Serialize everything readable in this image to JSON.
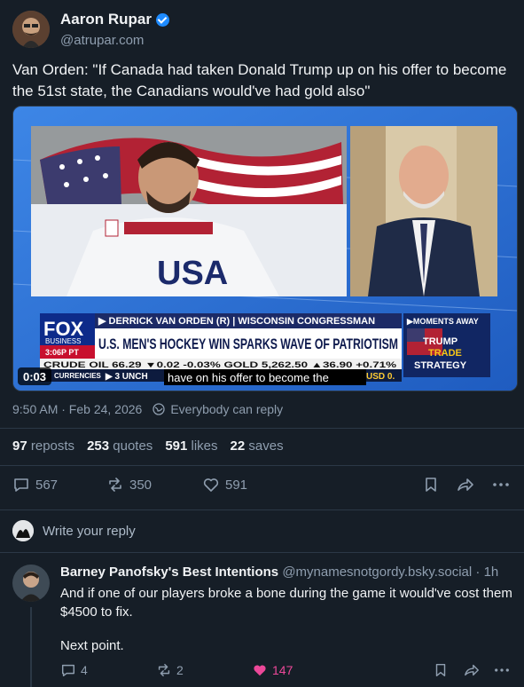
{
  "post": {
    "author_name": "Aaron Rupar",
    "author_handle": "@atrupar.com",
    "text": "Van Orden: \"If Canada had taken Donald Trump up on his offer to become the 51st state, the Canadians would've had gold also\"",
    "timestamp": "9:50 AM · Feb 24, 2026",
    "reply_setting": "Everybody can reply",
    "stats": {
      "reposts_count": "97",
      "reposts_label": "reposts",
      "quotes_count": "253",
      "quotes_label": "quotes",
      "likes_count": "591",
      "likes_label": "likes",
      "saves_count": "22",
      "saves_label": "saves"
    },
    "actions": {
      "replies": "567",
      "reposts": "350",
      "likes": "591"
    }
  },
  "video": {
    "duration": "0:03",
    "caption": "have on his offer to become the",
    "channel_logo": "FOX",
    "channel_sub": "BUSINESS",
    "clock": "3:06P PT",
    "lower_third_top": "▶ DERRICK VAN ORDEN (R) | WISCONSIN CONGRESSMAN",
    "headline": "U.S. MEN'S HOCKEY WIN SPARKS WAVE OF PATRIOTISM",
    "moments_away": "▶MOMENTS AWAY",
    "promo_line1": "TRUMP",
    "promo_line2": "TRADE",
    "promo_line3": "STRATEGY",
    "ticker_row1": "CRUDE OIL     66.29 ▼0.02  -0.03%  GOLD       5,262.50 ▲36.90 +0.71%",
    "ticker_row2_label": "CURRENCIES",
    "ticker_row2_rest": "▶ 3  UNCH",
    "ticker_row2_end": "USD  0.",
    "jersey_text": "USA"
  },
  "reply_prompt": "Write your reply",
  "reply": {
    "author_name": "Barney Panofsky's Best Intentions",
    "author_handle": "@mynamesnotgordy.bsky.social",
    "time": "· 1h",
    "text_line1": "And if one of our players broke a bone during the game it would've cost them $4500 to fix.",
    "text_line2": "Next point.",
    "replies": "4",
    "reposts": "2",
    "likes": "147"
  },
  "colors": {
    "background": "#161e27",
    "accent": "#1e8bff",
    "like_pink": "#ec4899",
    "muted": "#8f9eaf"
  }
}
